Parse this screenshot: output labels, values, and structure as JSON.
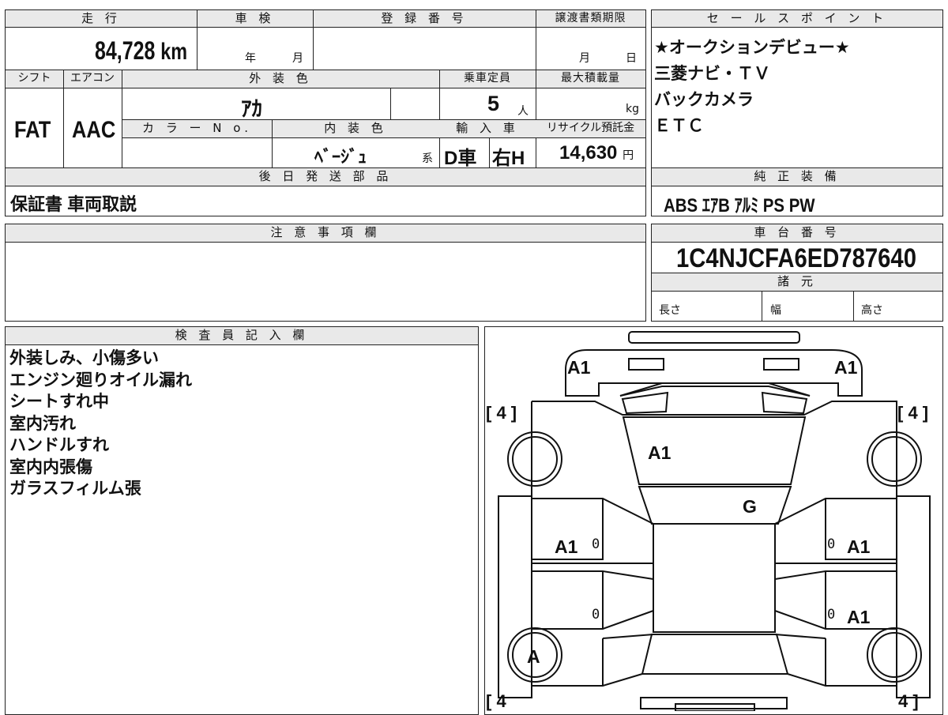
{
  "top_info": {
    "headers": {
      "mileage": "走 行",
      "inspection": "車 検",
      "registration": "登 録 番 号",
      "transfer_deadline": "譲渡書類期限",
      "shift": "シフト",
      "aircon": "エアコン",
      "exterior_color": "外 装 色",
      "capacity": "乗車定員",
      "max_load": "最大積載量",
      "color_no": "カ ラ ー N o.",
      "interior_color": "内 装 色",
      "import": "輸 入 車",
      "recycle_fee": "リサイクル預託金",
      "later_parts": "後 日 発 送 部 品"
    },
    "mileage_value": "84,728",
    "mileage_unit": "km",
    "inspection_year": "年",
    "inspection_month": "月",
    "transfer_month": "月",
    "transfer_day": "日",
    "shift_value": "FAT",
    "aircon_value": "AAC",
    "exterior_color_value": "ｱｶ",
    "capacity_value": "5",
    "capacity_unit": "人",
    "max_load_unit": "kg",
    "interior_color_value": "ﾍﾞｰｼﾞｭ",
    "interior_suffix": "系",
    "import_value": "D車",
    "steering_value": "右H",
    "recycle_value": "14,630",
    "recycle_unit": "円",
    "later_parts_value": "保証書 車両取説"
  },
  "sales_points": {
    "header": "セ ー ル ス ポ イ ン ト",
    "items": [
      "★オークションデビュー★",
      "三菱ナビ・ＴＶ",
      "バックカメラ",
      "ＥＴＣ"
    ]
  },
  "standard_equipment": {
    "header": "純 正 装 備",
    "value": "ABS ｴｱB ｱﾙﾐ PS PW"
  },
  "notes": {
    "header": "注 意 事 項 欄"
  },
  "chassis": {
    "header": "車 台 番 号",
    "value": "1C4NJCFA6ED787640",
    "specs_header": "諸 元",
    "length_label": "長さ",
    "width_label": "幅",
    "height_label": "高さ"
  },
  "inspector": {
    "header": "検 査 員 記 入 欄",
    "items": [
      "外装しみ、小傷多い",
      "エンジン廻りオイル漏れ",
      "シートすれ中",
      "室内汚れ",
      "ハンドルすれ",
      "室内内張傷",
      "ガラスフィルム張"
    ]
  },
  "diagram": {
    "tire_front_left": "[ 4 ]",
    "tire_front_right": "[ 4 ]",
    "tire_rear_left": "[ 4",
    "tire_rear_right": "4 ]",
    "front_left_corner": "A1",
    "front_right_corner": "A1",
    "hood": "A1",
    "windshield": "G",
    "front_left_door": "A1",
    "front_left_door_num": "0",
    "front_right_door": "A1",
    "front_right_door_num": "0",
    "rear_left_door_num": "0",
    "rear_right_door": "A1",
    "rear_right_door_num": "0",
    "rear_left_wheel": "A"
  }
}
